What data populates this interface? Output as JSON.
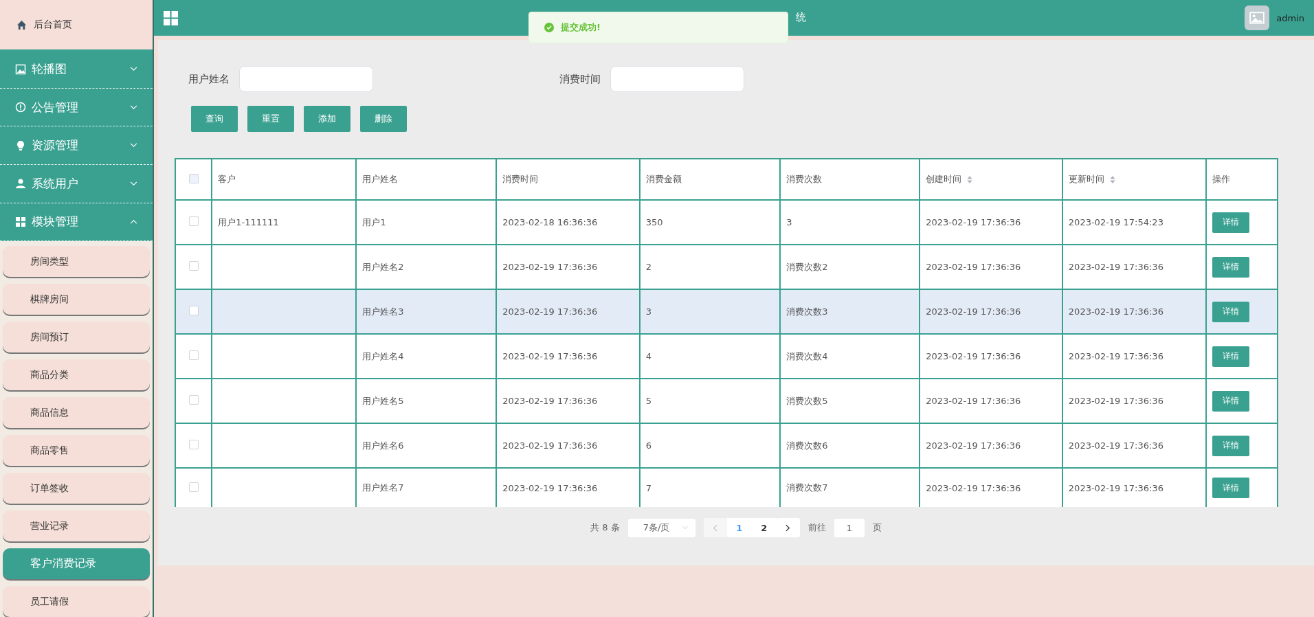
{
  "sidebar": {
    "home": {
      "label": "后台首页"
    },
    "groups": [
      {
        "label": "轮播图",
        "expanded": false
      },
      {
        "label": "公告管理",
        "expanded": false
      },
      {
        "label": "资源管理",
        "expanded": false
      },
      {
        "label": "系统用户",
        "expanded": false
      },
      {
        "label": "模块管理",
        "expanded": true,
        "children": [
          {
            "label": "房间类型",
            "selected": false
          },
          {
            "label": "棋牌房间",
            "selected": false
          },
          {
            "label": "房间预订",
            "selected": false
          },
          {
            "label": "商品分类",
            "selected": false
          },
          {
            "label": "商品信息",
            "selected": false
          },
          {
            "label": "商品零售",
            "selected": false
          },
          {
            "label": "订单签收",
            "selected": false
          },
          {
            "label": "营业记录",
            "selected": false
          },
          {
            "label": "客户消费记录",
            "selected": true
          },
          {
            "label": "员工请假",
            "selected": false
          }
        ]
      }
    ]
  },
  "header": {
    "title": "统",
    "user": "admin"
  },
  "toast": {
    "message": "提交成功!"
  },
  "search": {
    "fields": [
      {
        "label": "用户姓名"
      },
      {
        "label": "消费时间"
      }
    ],
    "buttons": [
      "查询",
      "重置",
      "添加",
      "删除"
    ]
  },
  "table": {
    "select_all": {
      "checked": false
    },
    "columns": [
      {
        "label": "客户",
        "sortable": false
      },
      {
        "label": "用户姓名",
        "sortable": false
      },
      {
        "label": "消费时间",
        "sortable": false
      },
      {
        "label": "消费金额",
        "sortable": false
      },
      {
        "label": "消费次数",
        "sortable": false
      },
      {
        "label": "创建时间",
        "sortable": true
      },
      {
        "label": "更新时间",
        "sortable": true
      },
      {
        "label": "操作",
        "sortable": false
      }
    ],
    "rows": [
      {
        "checked": false,
        "highlighted": false,
        "cells": [
          "用户1-111111",
          "用户1",
          "2023-02-18 16:36:36",
          "350",
          "3",
          "2023-02-19 17:36:36",
          "2023-02-19 17:54:23"
        ],
        "action": "详情"
      },
      {
        "checked": false,
        "highlighted": false,
        "cells": [
          "",
          "用户姓名2",
          "2023-02-19 17:36:36",
          "2",
          "消费次数2",
          "2023-02-19 17:36:36",
          "2023-02-19 17:36:36"
        ],
        "action": "详情"
      },
      {
        "checked": false,
        "highlighted": true,
        "cells": [
          "",
          "用户姓名3",
          "2023-02-19 17:36:36",
          "3",
          "消费次数3",
          "2023-02-19 17:36:36",
          "2023-02-19 17:36:36"
        ],
        "action": "详情"
      },
      {
        "checked": false,
        "highlighted": false,
        "cells": [
          "",
          "用户姓名4",
          "2023-02-19 17:36:36",
          "4",
          "消费次数4",
          "2023-02-19 17:36:36",
          "2023-02-19 17:36:36"
        ],
        "action": "详情"
      },
      {
        "checked": false,
        "highlighted": false,
        "cells": [
          "",
          "用户姓名5",
          "2023-02-19 17:36:36",
          "5",
          "消费次数5",
          "2023-02-19 17:36:36",
          "2023-02-19 17:36:36"
        ],
        "action": "详情"
      },
      {
        "checked": false,
        "highlighted": false,
        "cells": [
          "",
          "用户姓名6",
          "2023-02-19 17:36:36",
          "6",
          "消费次数6",
          "2023-02-19 17:36:36",
          "2023-02-19 17:36:36"
        ],
        "action": "详情"
      },
      {
        "checked": false,
        "highlighted": false,
        "cells": [
          "",
          "用户姓名7",
          "2023-02-19 17:36:36",
          "7",
          "消费次数7",
          "2023-02-19 17:36:36",
          "2023-02-19 17:36:36"
        ],
        "action": "详情"
      }
    ]
  },
  "pagination": {
    "total": "共 8 条",
    "page_size": "7条/页",
    "prev_disabled": true,
    "pages": [
      {
        "label": "1",
        "selected": true
      },
      {
        "label": "2",
        "selected": false
      }
    ],
    "goto_label": "前往",
    "goto_value": "1",
    "goto_suffix": "页"
  }
}
